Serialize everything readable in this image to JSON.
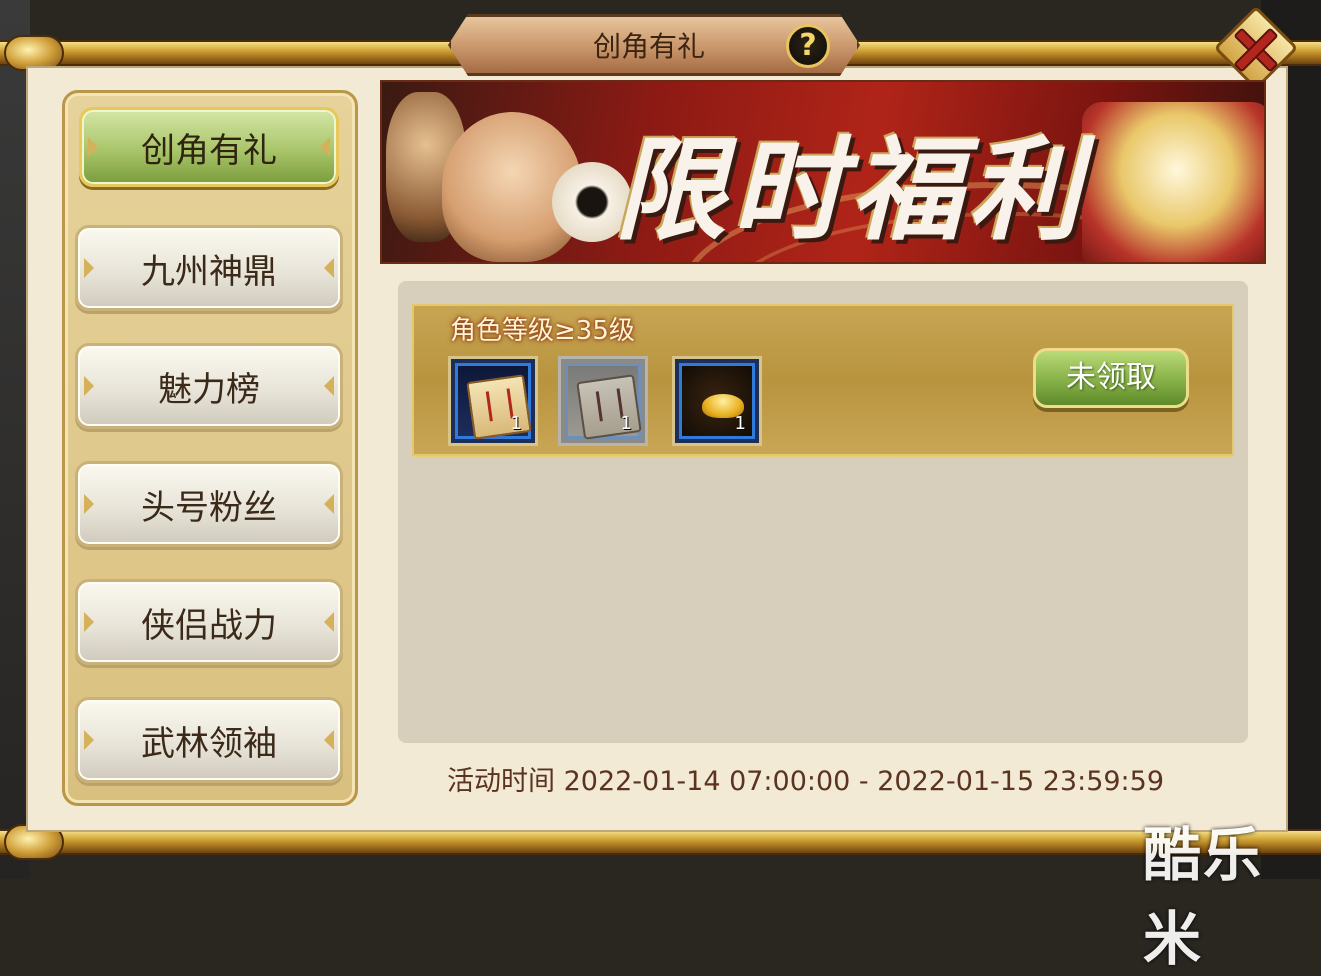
{
  "window": {
    "title": "创角有礼"
  },
  "sidebar": {
    "items": [
      {
        "label": "创角有礼",
        "active": true
      },
      {
        "label": "九州神鼎",
        "active": false
      },
      {
        "label": "魅力榜",
        "active": false
      },
      {
        "label": "头号粉丝",
        "active": false
      },
      {
        "label": "侠侣战力",
        "active": false
      },
      {
        "label": "武林领袖",
        "active": false
      }
    ]
  },
  "banner": {
    "text": "限时福利"
  },
  "task": {
    "title": "角色等级≥35级",
    "rewards": [
      {
        "icon": "scroll-icon",
        "quantity": "1"
      },
      {
        "icon": "scroll-icon",
        "quantity": "1",
        "dimmed": true
      },
      {
        "icon": "gold-ingot-icon",
        "quantity": "1"
      }
    ],
    "claim_label": "未领取"
  },
  "event_time": "活动时间 2022-01-14 07:00:00 - 2022-01-15 23:59:59",
  "watermark": "酷乐米",
  "colors": {
    "active_tab": "#a9c56a",
    "claim_button": "#87b148",
    "row_bg": "#b8943f"
  }
}
